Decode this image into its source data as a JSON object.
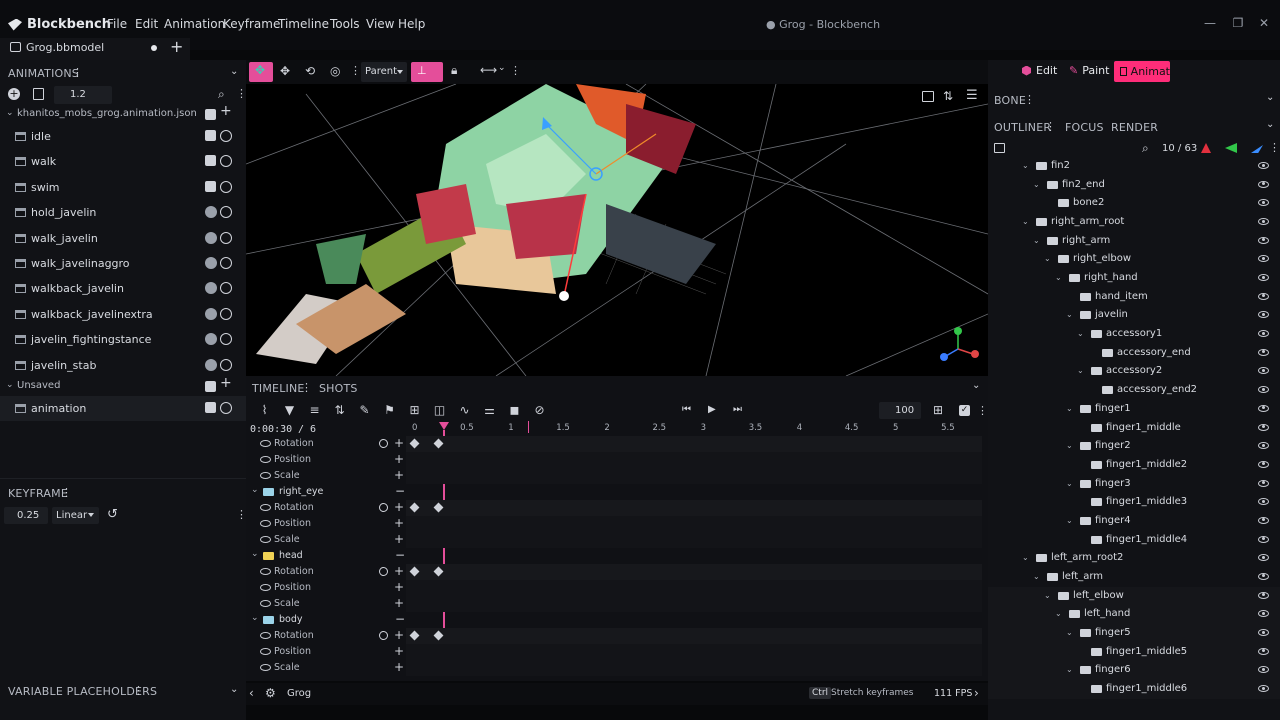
{
  "app": {
    "name": "Blockbench",
    "window_title": "● Grog - Blockbench"
  },
  "menu": [
    "File",
    "Edit",
    "Animation",
    "Keyframe",
    "Timeline",
    "Tools",
    "View",
    "Help"
  ],
  "tab": {
    "name": "Grog.bbmodel"
  },
  "animations": {
    "header": "ANIMATIONS",
    "length": "1.2",
    "file": "khanitos_mobs_grog.animation.json",
    "items": [
      "idle",
      "walk",
      "swim",
      "hold_javelin",
      "walk_javelin",
      "walk_javelinaggro",
      "walkback_javelin",
      "walkback_javelinextra",
      "javelin_fightingstance",
      "javelin_stab"
    ],
    "unsaved_label": "Unsaved",
    "unsaved_items": [
      "animation"
    ]
  },
  "keyframe": {
    "header": "KEYFRAME",
    "value": "0.25",
    "interpolation": "Linear"
  },
  "variables": {
    "header": "VARIABLE PLACEHOLDERS"
  },
  "toolbar": {
    "pivot_mode": "Parent"
  },
  "modes": {
    "edit": "Edit",
    "paint": "Paint",
    "animate": "Animat"
  },
  "timeline": {
    "tabs": [
      "TIMELINE",
      "SHOTS"
    ],
    "time": "0:00:30",
    "frames_total": "/ 6",
    "zoom": "100",
    "ticks": [
      "0",
      "0.5",
      "1",
      "1.5",
      "2",
      "2.5",
      "3",
      "3.5",
      "4",
      "4.5",
      "5",
      "5.5"
    ],
    "groups": [
      {
        "name": null,
        "channels": [
          "Rotation",
          "Position",
          "Scale"
        ]
      },
      {
        "name": "right_eye",
        "channels": [
          "Rotation",
          "Position",
          "Scale"
        ]
      },
      {
        "name": "head",
        "channels": [
          "Rotation",
          "Position",
          "Scale"
        ]
      },
      {
        "name": "body",
        "channels": [
          "Rotation",
          "Position",
          "Scale"
        ]
      }
    ]
  },
  "bottom": {
    "model": "Grog",
    "hint_key": "Ctrl",
    "hint": "Stretch keyframes",
    "fps": "111 FPS"
  },
  "right": {
    "bone_header": "BONE",
    "tabs": [
      "OUTLINER",
      "FOCUS",
      "RENDER"
    ],
    "count": "10 / 63",
    "tree": [
      {
        "name": "fin2",
        "d": 0,
        "open": true
      },
      {
        "name": "fin2_end",
        "d": 1,
        "open": true
      },
      {
        "name": "bone2",
        "d": 2,
        "open": null
      },
      {
        "name": "right_arm_root",
        "d": 0,
        "open": true
      },
      {
        "name": "right_arm",
        "d": 1,
        "open": true
      },
      {
        "name": "right_elbow",
        "d": 2,
        "open": true
      },
      {
        "name": "right_hand",
        "d": 3,
        "open": true
      },
      {
        "name": "hand_item",
        "d": 4,
        "open": null
      },
      {
        "name": "javelin",
        "d": 4,
        "open": true
      },
      {
        "name": "accessory1",
        "d": 5,
        "open": true
      },
      {
        "name": "accessory_end",
        "d": 6,
        "open": null
      },
      {
        "name": "accessory2",
        "d": 5,
        "open": true
      },
      {
        "name": "accessory_end2",
        "d": 6,
        "open": null
      },
      {
        "name": "finger1",
        "d": 4,
        "open": true
      },
      {
        "name": "finger1_middle",
        "d": 5,
        "open": null
      },
      {
        "name": "finger2",
        "d": 4,
        "open": true
      },
      {
        "name": "finger1_middle2",
        "d": 5,
        "open": null
      },
      {
        "name": "finger3",
        "d": 4,
        "open": true
      },
      {
        "name": "finger1_middle3",
        "d": 5,
        "open": null
      },
      {
        "name": "finger4",
        "d": 4,
        "open": true
      },
      {
        "name": "finger1_middle4",
        "d": 5,
        "open": null
      },
      {
        "name": "left_arm_root2",
        "d": 0,
        "open": true
      },
      {
        "name": "left_arm",
        "d": 1,
        "open": true
      },
      {
        "name": "left_elbow",
        "d": 2,
        "open": true
      },
      {
        "name": "left_hand",
        "d": 3,
        "open": true
      },
      {
        "name": "finger5",
        "d": 4,
        "open": true
      },
      {
        "name": "finger1_middle5",
        "d": 5,
        "open": null
      },
      {
        "name": "finger6",
        "d": 4,
        "open": true
      },
      {
        "name": "finger1_middle6",
        "d": 5,
        "open": null
      }
    ]
  },
  "colors": {
    "accent": "#e44e9a",
    "mode_active": "#ff2d79",
    "bg": "#111216"
  }
}
